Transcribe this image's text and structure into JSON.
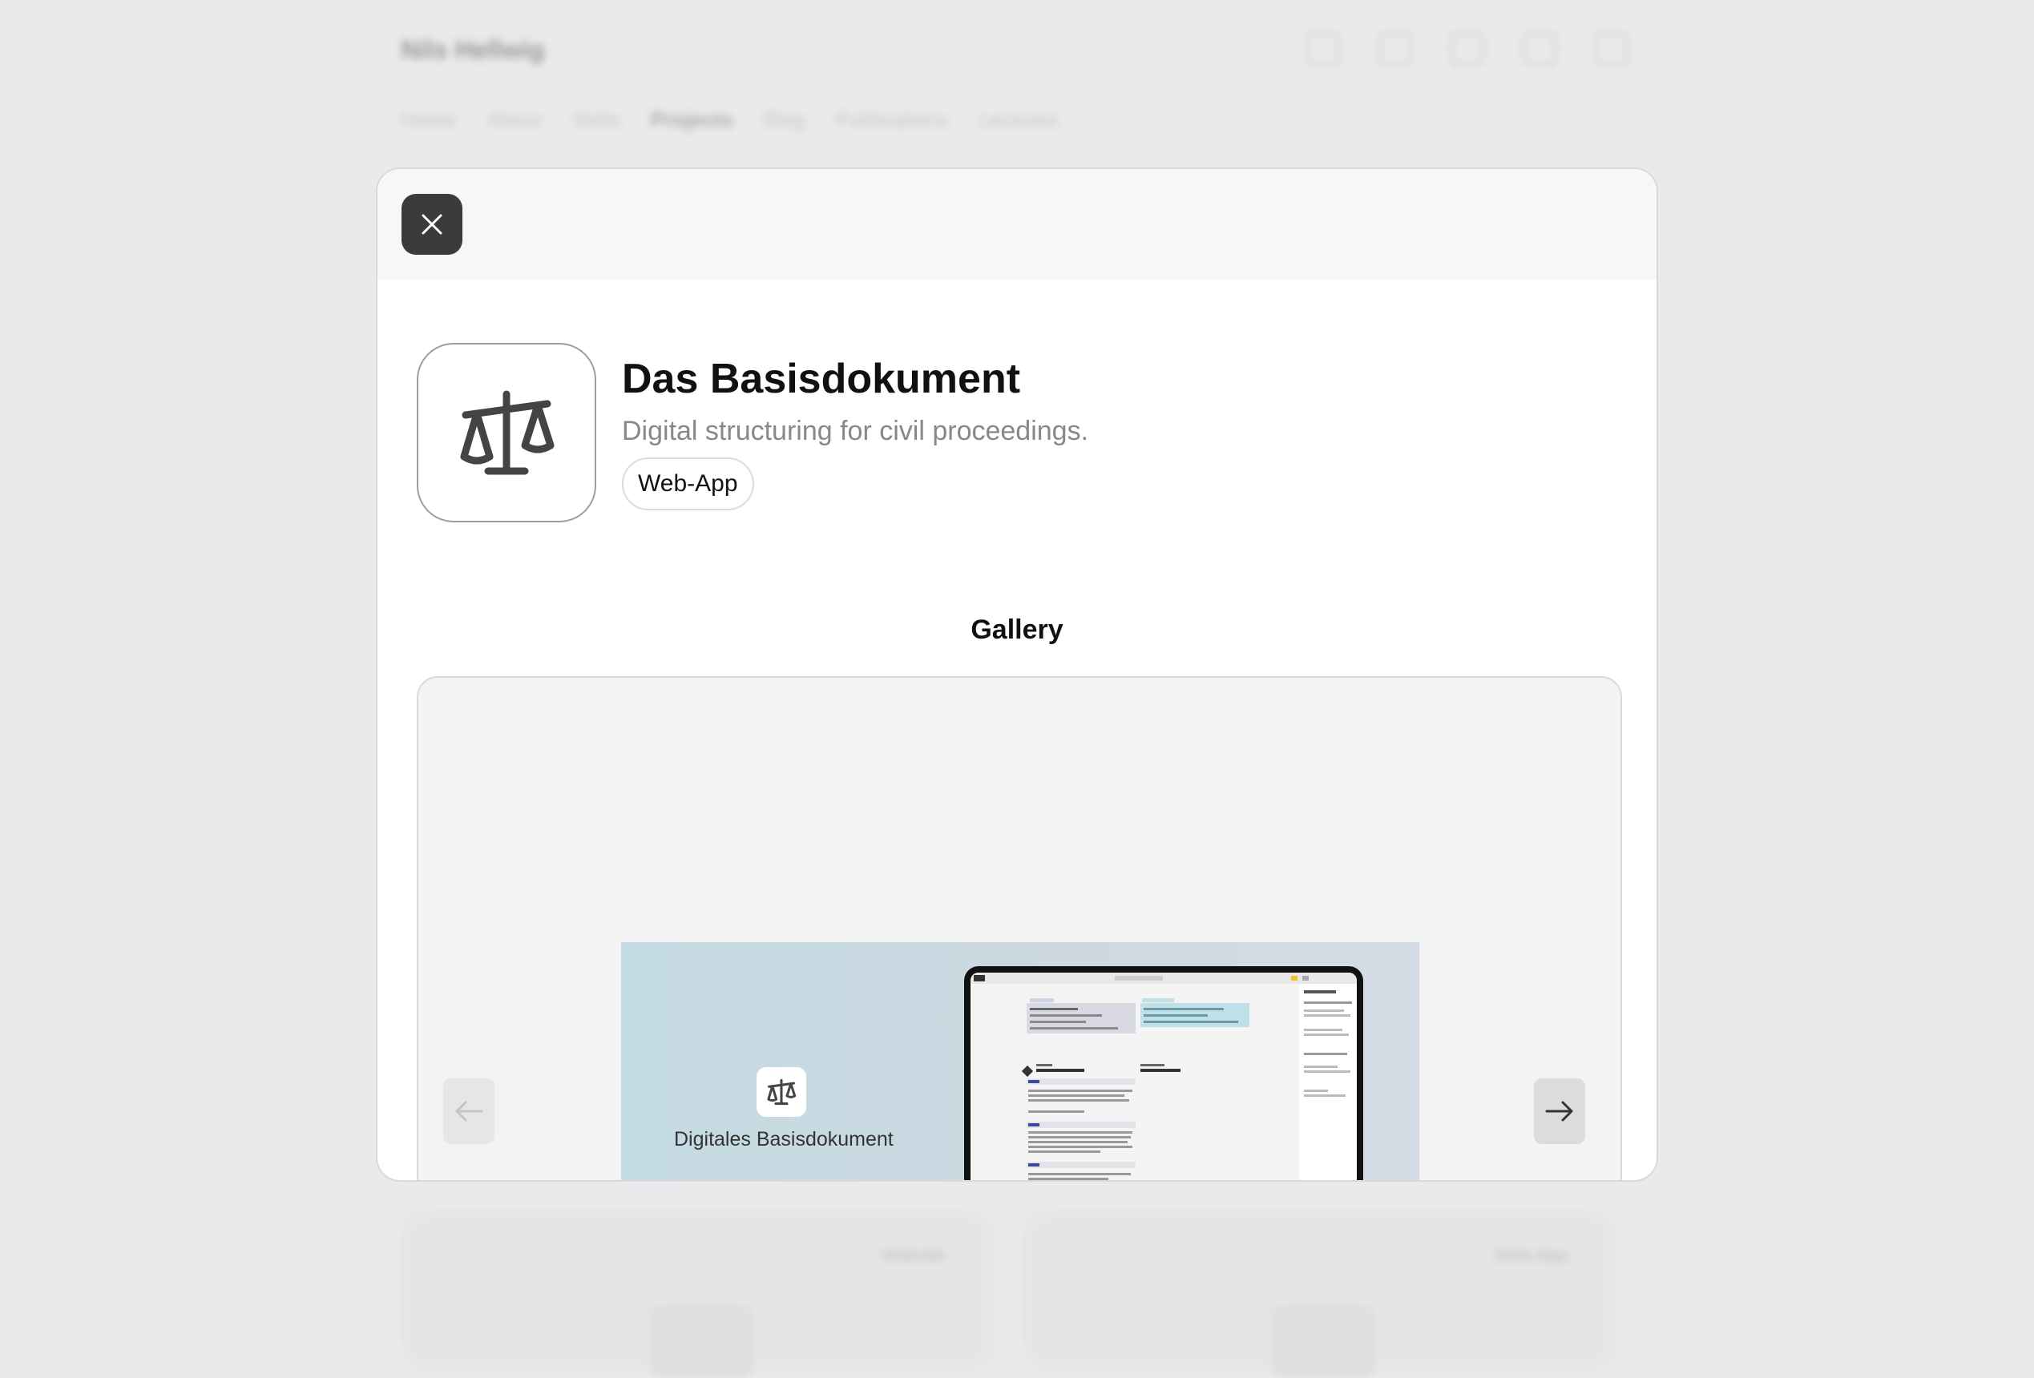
{
  "background": {
    "site_name": "Nils Hellwig",
    "nav": [
      "Home",
      "About",
      "Skills",
      "Projects",
      "Blog",
      "Publications",
      "Lectures"
    ],
    "cards": [
      {
        "tag": "Website"
      },
      {
        "tag": "Web-App"
      }
    ]
  },
  "modal": {
    "close_icon": "close-icon",
    "app": {
      "icon": "scales-icon",
      "title": "Das Basisdokument",
      "subtitle": "Digital structuring for civil proceedings.",
      "tag": "Web-App"
    },
    "gallery": {
      "title": "Gallery",
      "slide": {
        "icon": "scales-icon",
        "label": "Digitales Basisdokument"
      },
      "prev_icon": "arrow-left-icon",
      "next_icon": "arrow-right-icon"
    }
  }
}
